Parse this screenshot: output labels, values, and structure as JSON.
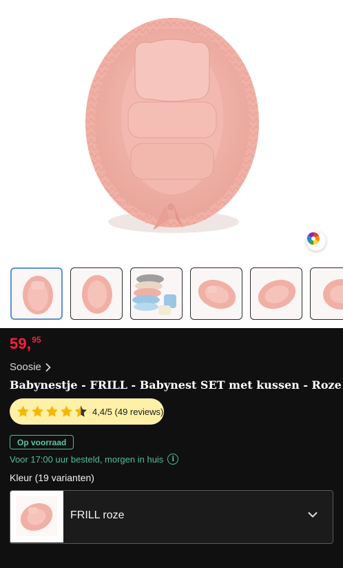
{
  "product": {
    "price_main": "59,",
    "price_cents": "95",
    "brand": "Soosie",
    "title": "Babynestje - FRILL - Babynest SET met kussen - Roze",
    "rating": {
      "stars": 4.4,
      "text": "4,4/5 (49 reviews)"
    },
    "availability_badge": "Op voorraad",
    "delivery_text": "Voor 17:00 uur besteld, morgen in huis",
    "variants_label": "Kleur (19 varianten)",
    "selected_variant": "FRILL roze"
  },
  "gallery": {
    "thumbnail_count": 6,
    "active_index": 0
  },
  "icons": {
    "color_picker": "color-wheel-icon",
    "brand_link": "chevron-right-icon",
    "delivery_info": "info-icon",
    "dropdown": "chevron-down-icon",
    "rating": "star-icon"
  },
  "colors": {
    "price": "#ff1f3a",
    "accent_green": "#4fbf96",
    "rating_bg": "#fff0a8",
    "star": "#f5b800",
    "product_pink": "#f0b3aa",
    "background": "#101010"
  }
}
